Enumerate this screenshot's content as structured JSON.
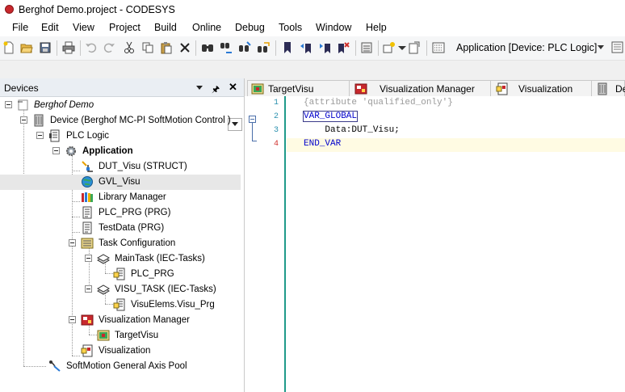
{
  "window": {
    "title": "Berghof Demo.project - CODESYS",
    "app_icon": "codesys-icon"
  },
  "menu": [
    "File",
    "Edit",
    "View",
    "Project",
    "Build",
    "Online",
    "Debug",
    "Tools",
    "Window",
    "Help"
  ],
  "toolbar": {
    "buttons": [
      "new-project-icon",
      "open-icon",
      "save-icon",
      "print-icon",
      "undo-icon",
      "redo-icon",
      "cut-icon",
      "copy-icon",
      "paste-icon",
      "delete-icon",
      "find-icon",
      "find-replace-icon",
      "binoculars-icon",
      "cross-reference-icon",
      "bookmark-icon",
      "bookmark-prev-icon",
      "bookmark-next-icon",
      "bookmark-clear-icon",
      "options-icon",
      "add-object-icon",
      "insert-icon",
      "properties-icon"
    ],
    "application_selector": "Application [Device: PLC Logic]"
  },
  "devices_panel": {
    "title": "Devices",
    "tree": [
      {
        "label": "Berghof Demo",
        "icon": "project-icon",
        "style": "italic"
      },
      {
        "label": "Device (Berghof MC-PI SoftMotion Control )",
        "icon": "device-icon"
      },
      {
        "label": "PLC Logic",
        "icon": "plc-logic-icon"
      },
      {
        "label": "Application",
        "icon": "application-gear-icon",
        "style": "bold"
      },
      {
        "label": "DUT_Visu (STRUCT)",
        "icon": "dut-icon"
      },
      {
        "label": "GVL_Visu",
        "icon": "gvl-globe-icon",
        "selected": true
      },
      {
        "label": "Library Manager",
        "icon": "library-icon"
      },
      {
        "label": "PLC_PRG (PRG)",
        "icon": "pou-icon"
      },
      {
        "label": "TestData (PRG)",
        "icon": "pou-icon"
      },
      {
        "label": "Task Configuration",
        "icon": "task-config-icon"
      },
      {
        "label": "MainTask (IEC-Tasks)",
        "icon": "task-icon"
      },
      {
        "label": "PLC_PRG",
        "icon": "program-call-icon"
      },
      {
        "label": "VISU_TASK (IEC-Tasks)",
        "icon": "task-icon"
      },
      {
        "label": "VisuElems.Visu_Prg",
        "icon": "program-call-icon"
      },
      {
        "label": "Visualization Manager",
        "icon": "visu-manager-icon"
      },
      {
        "label": "TargetVisu",
        "icon": "target-visu-icon"
      },
      {
        "label": "Visualization",
        "icon": "visualization-icon"
      },
      {
        "label": "SoftMotion General Axis Pool",
        "icon": "axis-pool-icon"
      }
    ]
  },
  "editor": {
    "tabs": [
      {
        "label": "TargetVisu",
        "icon": "target-visu-icon"
      },
      {
        "label": "Visualization Manager",
        "icon": "visu-manager-icon"
      },
      {
        "label": "Visualization",
        "icon": "visualization-icon"
      },
      {
        "label": "De",
        "icon": "device-icon"
      }
    ],
    "lines": [
      {
        "num": "1",
        "text": "{attribute 'qualified_only'}"
      },
      {
        "num": "2",
        "text": "VAR_GLOBAL"
      },
      {
        "num": "3",
        "text": "    Data:DUT_Visu;"
      },
      {
        "num": "4",
        "text": "END_VAR"
      }
    ]
  },
  "colors": {
    "accent_teal": "#1f9a8a",
    "keyword_blue": "#0000cc",
    "attribute_gray": "#9a9a9a",
    "line_number": "#2b91af",
    "current_line_number": "#d0312d"
  }
}
